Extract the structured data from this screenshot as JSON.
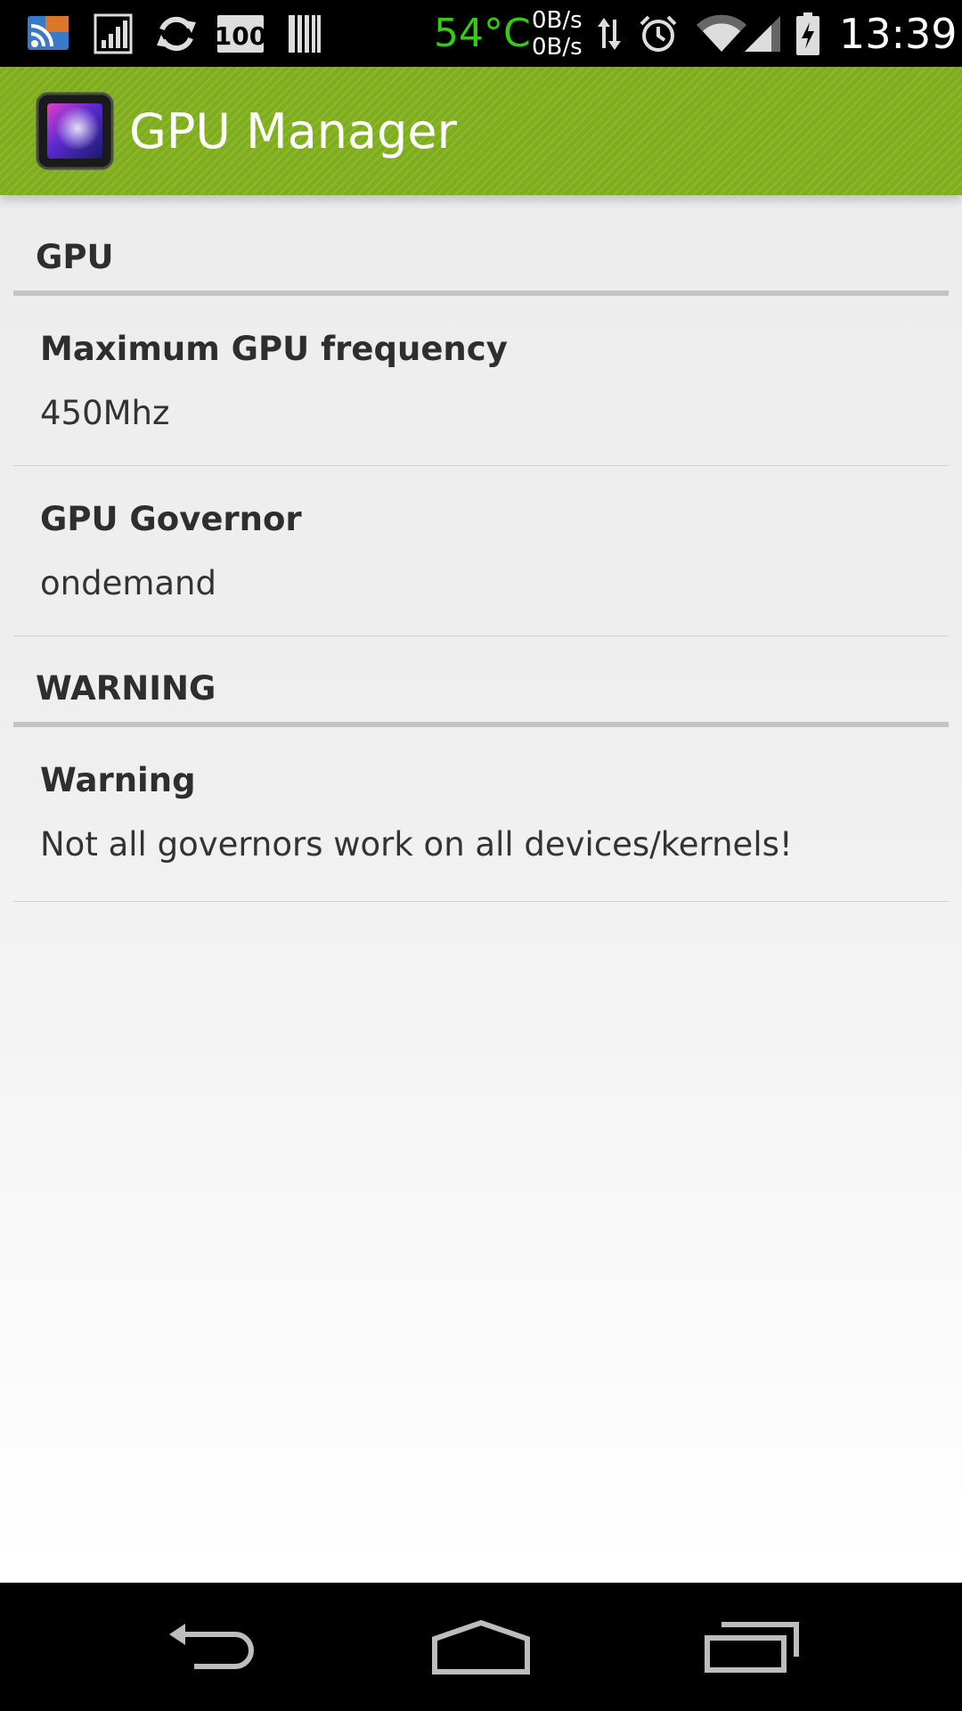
{
  "status_bar": {
    "temperature": "54°C",
    "net_up": "0B/s",
    "net_down": "0B/s",
    "time": "13:39",
    "battery_icon_text": "100",
    "icons": [
      "cast-icon",
      "signal-bars-icon",
      "sync-icon",
      "battery-percent-icon",
      "barcode-icon",
      "data-arrows-icon",
      "alarm-icon",
      "wifi-icon",
      "cell-signal-icon",
      "battery-charging-icon"
    ]
  },
  "action_bar": {
    "title": "GPU Manager",
    "icon": "gpu-chip-icon",
    "color": "#7fae1d"
  },
  "sections": [
    {
      "category": "GPU",
      "items": [
        {
          "title": "Maximum GPU frequency",
          "summary": "450Mhz"
        },
        {
          "title": "GPU Governor",
          "summary": "ondemand"
        }
      ]
    },
    {
      "category": "WARNING",
      "items": [
        {
          "title": "Warning",
          "summary": "Not all governors work on all devices/kernels!"
        }
      ]
    }
  ],
  "nav_bar": {
    "buttons": [
      "back-icon",
      "home-icon",
      "recents-icon"
    ]
  },
  "colors": {
    "temperature": "#33cc11",
    "accent": "#7fae1d",
    "divider": "#c4c4c4"
  }
}
